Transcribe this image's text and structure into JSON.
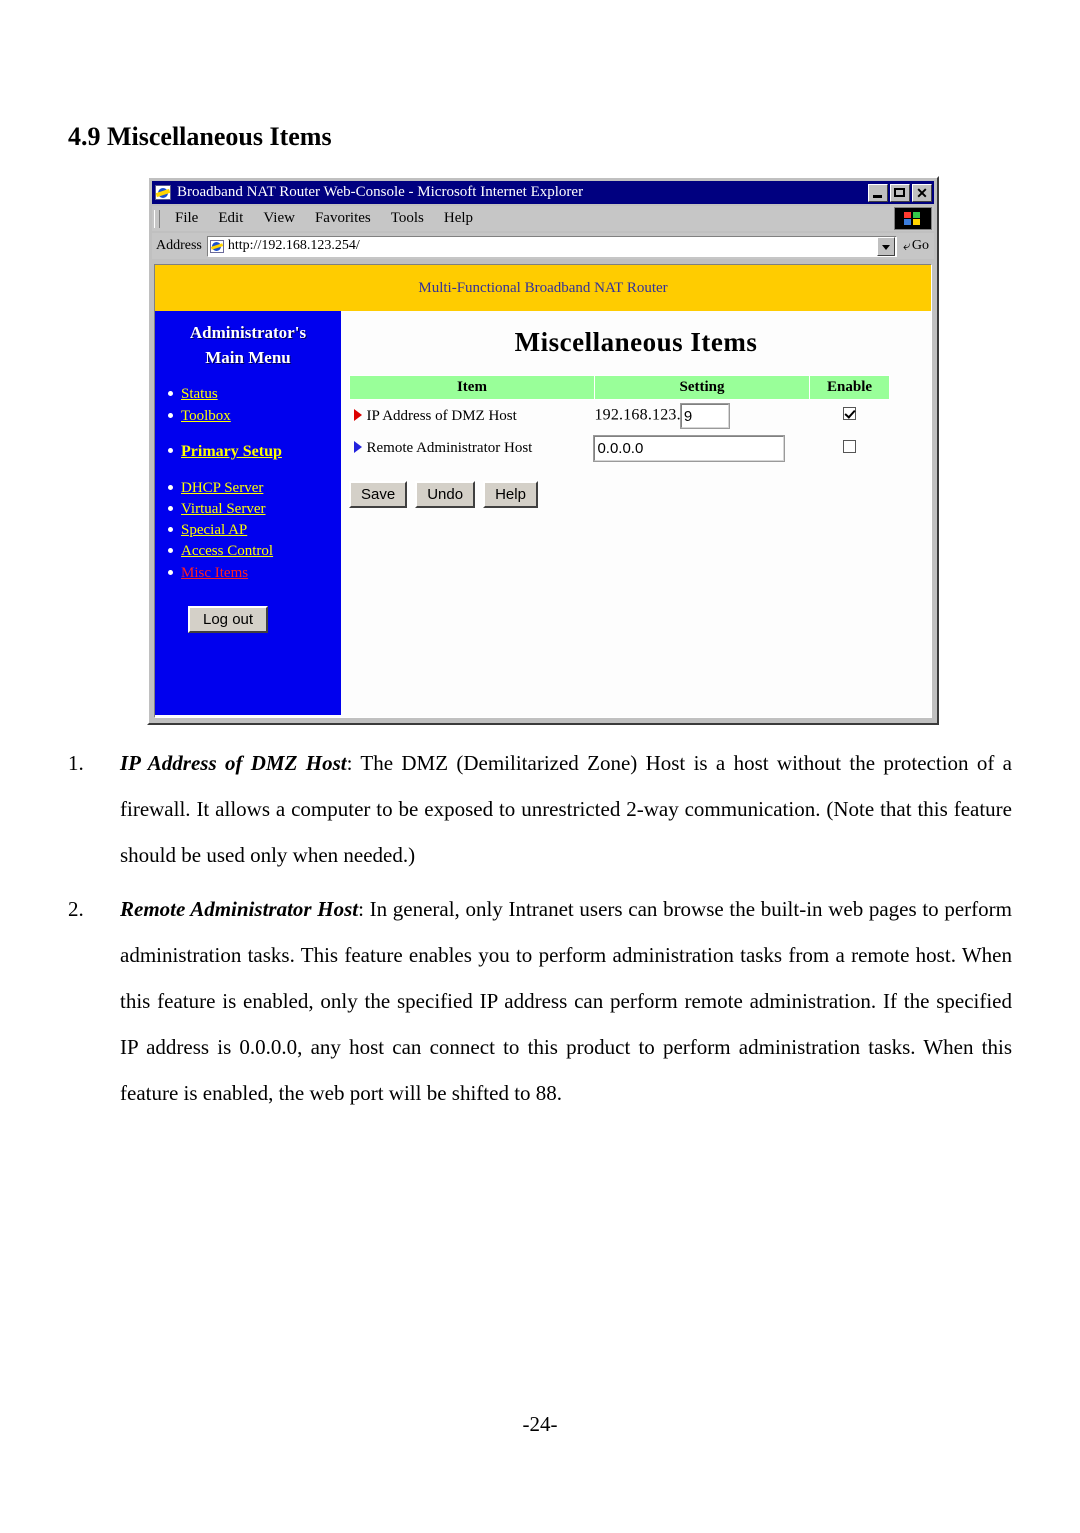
{
  "document": {
    "heading": "4.9 Miscellaneous Items",
    "page_number": "-24-",
    "paragraphs": [
      {
        "number": "1.",
        "term": "IP Address of DMZ Host",
        "text": ": The DMZ (Demilitarized Zone) Host is a host without the protection of a firewall. It allows a computer to be exposed to unrestricted 2-way communication. (Note that this feature should be used only when needed.)"
      },
      {
        "number": "2.",
        "term": "Remote Administrator Host",
        "text": ": In general, only Intranet users can browse the built-in web pages to perform administration tasks. This feature enables you to perform administration tasks from a remote host. When this feature is enabled, only the specified IP address can perform remote administration. If the specified IP address is 0.0.0.0, any host can connect to this product to perform administration tasks. When this feature is enabled, the web port will be shifted to 88."
      }
    ]
  },
  "browser": {
    "title": "Broadband NAT Router Web-Console - Microsoft Internet Explorer",
    "window_buttons": {
      "minimize": "minimize-icon",
      "maximize": "maximize-icon",
      "close": "✕"
    },
    "menu": [
      "File",
      "Edit",
      "View",
      "Favorites",
      "Tools",
      "Help"
    ],
    "address": {
      "label": "Address",
      "url": "http://192.168.123.254/",
      "go_label": "Go"
    }
  },
  "webpage": {
    "banner": "Multi-Functional Broadband NAT Router",
    "sidebar": {
      "title_line1": "Administrator's",
      "title_line2": "Main Menu",
      "items": [
        {
          "label": "Status",
          "style": "normal",
          "gap": false
        },
        {
          "label": "Toolbox",
          "style": "normal",
          "gap": false
        },
        {
          "label": "Primary Setup",
          "style": "bold",
          "gap": true
        },
        {
          "label": "DHCP Server",
          "style": "normal",
          "gap": true
        },
        {
          "label": "Virtual Server",
          "style": "normal",
          "gap": false
        },
        {
          "label": "Special AP",
          "style": "normal",
          "gap": false
        },
        {
          "label": "Access Control",
          "style": "normal",
          "gap": false
        },
        {
          "label": "Misc Items",
          "style": "active",
          "gap": false
        }
      ],
      "logout_label": "Log out"
    },
    "page_title": "Miscellaneous Items",
    "table": {
      "headers": [
        "Item",
        "Setting",
        "Enable"
      ],
      "rows": [
        {
          "bullet_color": "#dd0000",
          "item": "IP Address of DMZ Host",
          "prefix": "192.168.123.",
          "value": "9",
          "enabled": true
        },
        {
          "bullet_color": "#2222dd",
          "item": "Remote Administrator Host",
          "prefix": "",
          "value": "0.0.0.0",
          "enabled": false
        }
      ]
    },
    "buttons": [
      "Save",
      "Undo",
      "Help"
    ],
    "colors": {
      "banner_bg": "#ffcc00",
      "banner_text": "#333399",
      "sidebar_bg": "#0000ee",
      "link": "#ffff00",
      "active_link": "#ff2020",
      "table_header_bg": "#99ff99"
    }
  }
}
